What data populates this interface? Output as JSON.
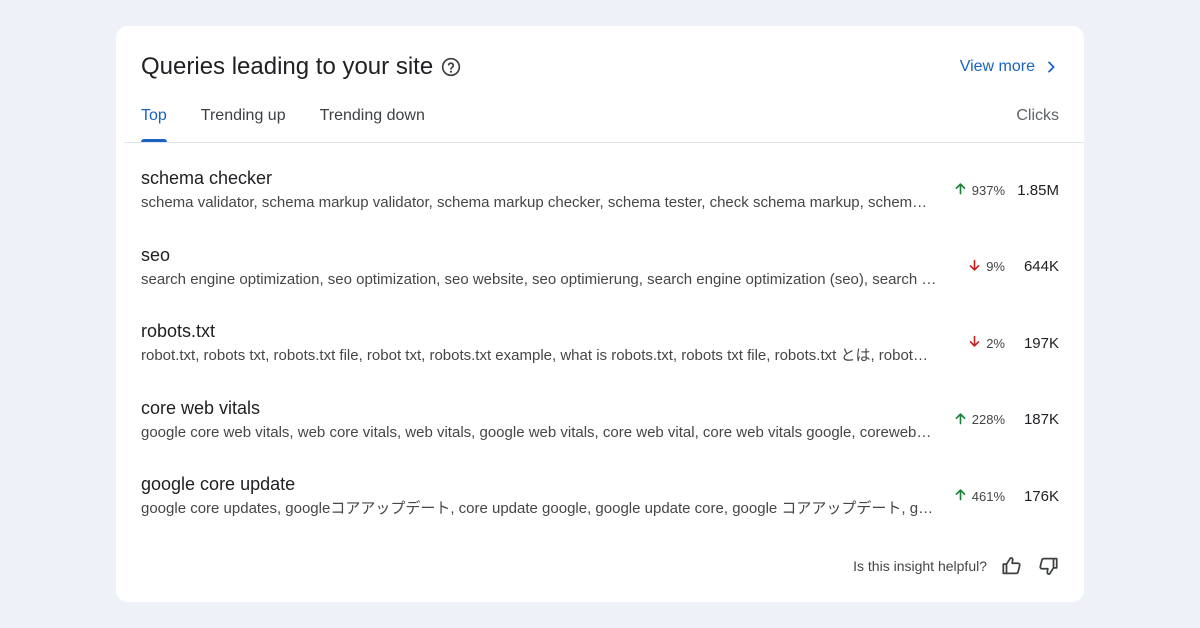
{
  "header": {
    "title": "Queries leading to your site",
    "view_more": "View more"
  },
  "tabs": [
    {
      "label": "Top",
      "active": true
    },
    {
      "label": "Trending up",
      "active": false
    },
    {
      "label": "Trending down",
      "active": false
    }
  ],
  "column_header": "Clicks",
  "rows": [
    {
      "query": "schema checker",
      "related": "schema validator, schema markup validator, schema markup checker, schema tester, check schema markup, schem…",
      "trend": "up",
      "change": "937%",
      "clicks": "1.85M"
    },
    {
      "query": "seo",
      "related": "search engine optimization, seo optimization, seo website, seo optimierung, search engine optimization (seo), search …",
      "trend": "down",
      "change": "9%",
      "clicks": "644K"
    },
    {
      "query": "robots.txt",
      "related": "robot.txt, robots txt, robots.txt file, robot txt, robots.txt example, what is robots.txt, robots txt file, robots.txt とは, robot…",
      "trend": "down",
      "change": "2%",
      "clicks": "197K"
    },
    {
      "query": "core web vitals",
      "related": "google core web vitals, web core vitals, web vitals, google web vitals, core web vital, core web vitals google, coreweb…",
      "trend": "up",
      "change": "228%",
      "clicks": "187K"
    },
    {
      "query": "google core update",
      "related": "google core updates, googleコアアップデート, core update google, google update core, google コアアップデート, g…",
      "trend": "up",
      "change": "461%",
      "clicks": "176K"
    }
  ],
  "feedback": {
    "question": "Is this insight helpful?"
  },
  "colors": {
    "accent": "#1a63c2",
    "up": "#188038",
    "down": "#c5221f",
    "background": "#eef2f8"
  }
}
